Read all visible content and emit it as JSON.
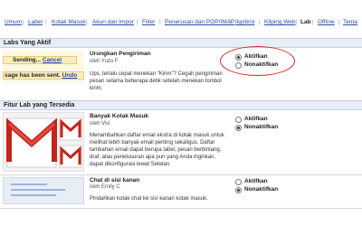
{
  "tabs": [
    {
      "label": "Umum"
    },
    {
      "label": "Label"
    },
    {
      "label": "Kotak Masuk"
    },
    {
      "label": "Akun dan Impor"
    },
    {
      "label": "Filter"
    },
    {
      "label": "Penerusan dan POP/IMAP"
    },
    {
      "label": "Ilgobrol"
    },
    {
      "label": "Kliping Web"
    },
    {
      "label": "Lab"
    },
    {
      "label": "Offline"
    },
    {
      "label": "Tema"
    }
  ],
  "sections": {
    "active_title": "Labs Yang Aktif",
    "available_title": "Fitur Lab yang Tersedia"
  },
  "labs": [
    {
      "title": "Urungkan Pengiriman",
      "author": "oleh Yuzo F",
      "description": "Ups, terlalu cepat menekan \"Kirim\"? Cegah pengiriman pesan selama beberapa detik setelah menekan tombol kirim.",
      "option_on": "Aktifkan",
      "option_off": "Nonaktifkan",
      "selected": "on",
      "preview": {
        "sending_text": "Sending...",
        "cancel_link": "Cancel",
        "sent_text": "sage has been sent.",
        "undo_link": "Undo"
      }
    },
    {
      "title": "Banyak Kotak Masuk",
      "author": "oleh Vivi",
      "description": "Menambahkan daftar email ekstra di kotak masuk untuk melihat lebih banyak email penting sekaligus. Daftar tambahan email dapat berupa label, pesan berbintang, draf, atau penelusuran apa pun yang Anda inginkan, dapat dikonfigurasi lewat Setelan.",
      "option_on": "Aktifkan",
      "option_off": "Nonaktifkan",
      "selected": "off"
    },
    {
      "title": "Chat di sisi kanan",
      "author": "oleh Emily C",
      "description": "Pindahkan kotak chat ke sisi kanan kotak masuk.",
      "option_on": "Aktifkan",
      "option_off": "Nonaktifkan",
      "selected": "off"
    }
  ],
  "colors": {
    "link": "#2a4aa8",
    "section_bg": "#e8eef6",
    "highlight": "#d42a2a",
    "gmail_red": "#c5241b"
  },
  "icons": {
    "multiple_inbox": "gmail-m-logo-icon"
  }
}
